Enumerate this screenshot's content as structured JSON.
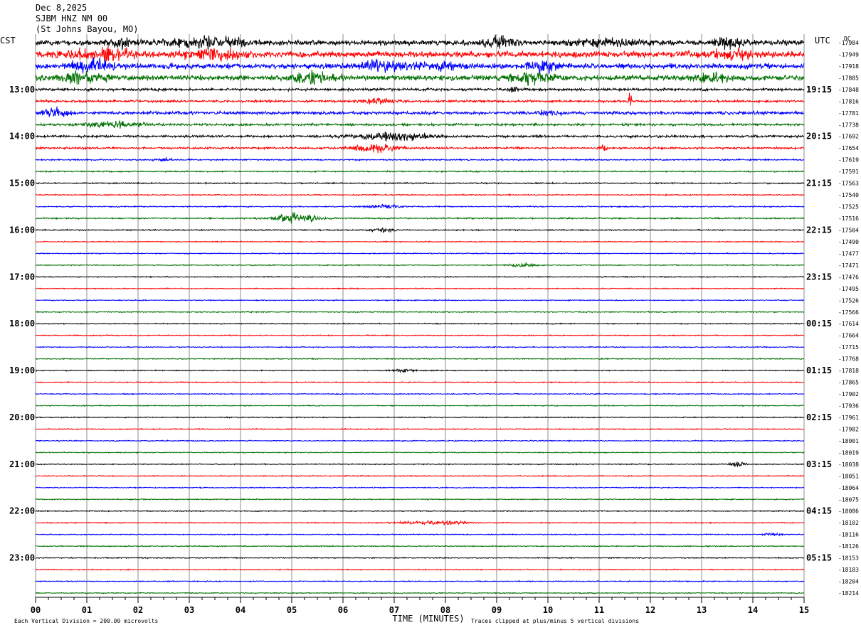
{
  "header": {
    "date": "Dec 8,2025",
    "station": "SJBM HNZ NM 00",
    "location": "(St Johns Bayou, MO)"
  },
  "chart_data": {
    "type": "line",
    "title": "",
    "left_axis_label": "CST",
    "right_axis_label": "UTC",
    "dc_label": "DC",
    "xlabel": "TIME (MINUTES)",
    "x_ticks": [
      "00",
      "01",
      "02",
      "03",
      "04",
      "05",
      "06",
      "07",
      "08",
      "09",
      "10",
      "11",
      "12",
      "13",
      "14",
      "15"
    ],
    "xlim": [
      0,
      15
    ],
    "left_hour_labels": [
      "13:00",
      "14:00",
      "15:00",
      "16:00",
      "17:00",
      "18:00",
      "19:00",
      "20:00",
      "21:00",
      "22:00",
      "23:00"
    ],
    "right_hour_labels": [
      "19:15",
      "20:15",
      "21:15",
      "22:15",
      "23:15",
      "00:15",
      "01:15",
      "02:15",
      "03:15",
      "04:15",
      "05:15"
    ],
    "first_labeled_trace": 4,
    "traces_per_hour": 4,
    "trace_colors": [
      "#000000",
      "#ff0000",
      "#0000ff",
      "#007000"
    ],
    "dc_offsets": [
      -17984,
      -17949,
      -17918,
      -17885,
      -17848,
      -17816,
      -17781,
      -17738,
      -17692,
      -17654,
      -17619,
      -17591,
      -17563,
      -17540,
      -17525,
      -17516,
      -17504,
      -17490,
      -17477,
      -17471,
      -17476,
      -17495,
      -17526,
      -17566,
      -17614,
      -17664,
      -17715,
      -17768,
      -17818,
      -17865,
      -17902,
      -17936,
      -17961,
      -17982,
      -18001,
      -18019,
      -18038,
      -18051,
      -18064,
      -18075,
      -18086,
      -18102,
      -18116,
      -18126,
      -18153,
      -18183,
      -18204,
      -18214
    ],
    "noise_level": [
      3.6,
      4.2,
      3.8,
      3.6,
      1.8,
      1.6,
      2.2,
      1.6,
      1.6,
      1.4,
      1.0,
      0.9,
      0.9,
      0.8,
      0.8,
      1.0,
      0.8,
      0.7,
      0.7,
      0.7,
      0.7,
      0.7,
      0.7,
      0.7,
      0.7,
      0.7,
      0.7,
      0.7,
      0.7,
      0.7,
      0.7,
      0.7,
      0.7,
      0.7,
      0.7,
      0.7,
      0.7,
      0.7,
      0.7,
      0.7,
      0.7,
      0.7,
      0.7,
      0.7,
      0.7,
      0.7,
      0.7,
      0.7
    ],
    "events": [
      {
        "trace": 0,
        "minute": 1.7,
        "amplitude": 6,
        "width": 0.3
      },
      {
        "trace": 0,
        "minute": 3.4,
        "amplitude": 7,
        "width": 1.0
      },
      {
        "trace": 0,
        "minute": 9.1,
        "amplitude": 8,
        "width": 0.4
      },
      {
        "trace": 0,
        "minute": 11.0,
        "amplitude": 5,
        "width": 0.8
      },
      {
        "trace": 0,
        "minute": 13.5,
        "amplitude": 8,
        "width": 0.3
      },
      {
        "trace": 1,
        "minute": 1.3,
        "amplitude": 8,
        "width": 0.8
      },
      {
        "trace": 1,
        "minute": 3.4,
        "amplitude": 7,
        "width": 0.7
      },
      {
        "trace": 1,
        "minute": 13.6,
        "amplitude": 6,
        "width": 0.5
      },
      {
        "trace": 2,
        "minute": 1.1,
        "amplitude": 8,
        "width": 0.5
      },
      {
        "trace": 2,
        "minute": 6.7,
        "amplitude": 6,
        "width": 0.6
      },
      {
        "trace": 2,
        "minute": 7.9,
        "amplitude": 5,
        "width": 0.5
      },
      {
        "trace": 2,
        "minute": 9.9,
        "amplitude": 7,
        "width": 0.4
      },
      {
        "trace": 3,
        "minute": 0.9,
        "amplitude": 6,
        "width": 0.6
      },
      {
        "trace": 3,
        "minute": 5.4,
        "amplitude": 7,
        "width": 0.5
      },
      {
        "trace": 3,
        "minute": 9.7,
        "amplitude": 8,
        "width": 0.5
      },
      {
        "trace": 3,
        "minute": 13.2,
        "amplitude": 5,
        "width": 0.5
      },
      {
        "trace": 4,
        "minute": 9.3,
        "amplitude": 5,
        "width": 0.2
      },
      {
        "trace": 5,
        "minute": 6.7,
        "amplitude": 4,
        "width": 0.4
      },
      {
        "trace": 5,
        "minute": 11.6,
        "amplitude": 14,
        "width": 0.04
      },
      {
        "trace": 6,
        "minute": 0.4,
        "amplitude": 7,
        "width": 0.3
      },
      {
        "trace": 6,
        "minute": 10.0,
        "amplitude": 3,
        "width": 0.3
      },
      {
        "trace": 7,
        "minute": 1.5,
        "amplitude": 4,
        "width": 0.7
      },
      {
        "trace": 8,
        "minute": 7.0,
        "amplitude": 5,
        "width": 1.0
      },
      {
        "trace": 9,
        "minute": 6.6,
        "amplitude": 5,
        "width": 0.6
      },
      {
        "trace": 9,
        "minute": 11.1,
        "amplitude": 4,
        "width": 0.1
      },
      {
        "trace": 10,
        "minute": 2.5,
        "amplitude": 2,
        "width": 0.2
      },
      {
        "trace": 14,
        "minute": 6.8,
        "amplitude": 3,
        "width": 0.4
      },
      {
        "trace": 15,
        "minute": 5.1,
        "amplitude": 7,
        "width": 0.5
      },
      {
        "trace": 16,
        "minute": 6.8,
        "amplitude": 3,
        "width": 0.3
      },
      {
        "trace": 19,
        "minute": 9.5,
        "amplitude": 3,
        "width": 0.3
      },
      {
        "trace": 28,
        "minute": 7.2,
        "amplitude": 2,
        "width": 0.3
      },
      {
        "trace": 36,
        "minute": 13.7,
        "amplitude": 3,
        "width": 0.2
      },
      {
        "trace": 41,
        "minute": 7.5,
        "amplitude": 2,
        "width": 0.6
      },
      {
        "trace": 41,
        "minute": 8.1,
        "amplitude": 2,
        "width": 0.4
      },
      {
        "trace": 42,
        "minute": 14.4,
        "amplitude": 2,
        "width": 0.2
      }
    ]
  },
  "footer": {
    "vertical_division": "Each Vertical Division =  200.00 microvolts",
    "clip_note": "Traces clipped at plus/minus 5 vertical divisions"
  }
}
